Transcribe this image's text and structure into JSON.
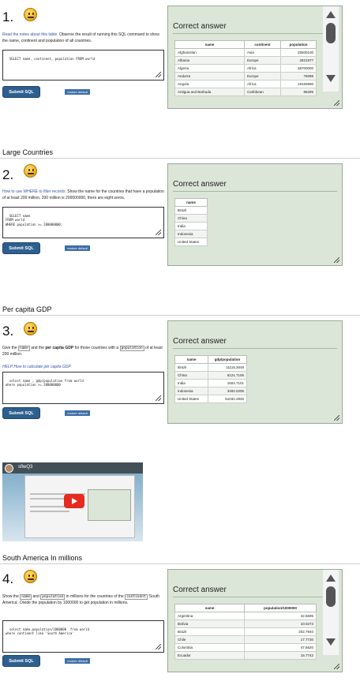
{
  "common": {
    "submit_label": "Submit SQL",
    "restore_label": "restore default",
    "answer_title": "Correct answer"
  },
  "q1": {
    "number": "1.",
    "prompt_link": "Read the notes about this table.",
    "prompt_rest": " Observe the result of running this SQL command to show the name, continent and population of all countries.",
    "sql": "SELECT name, continent, population FROM world",
    "columns": [
      "name",
      "continent",
      "population"
    ],
    "rows": [
      [
        "Afghanistan",
        "Asia",
        "25500100"
      ],
      [
        "Albania",
        "Europe",
        "2821977"
      ],
      [
        "Algeria",
        "Africa",
        "38700000"
      ],
      [
        "Andorra",
        "Europe",
        "76098"
      ],
      [
        "Angola",
        "Africa",
        "19183590"
      ],
      [
        "Antigua and Barbuda",
        "Caribbean",
        "86295"
      ]
    ]
  },
  "s2": {
    "title": "Large Countries"
  },
  "q2": {
    "number": "2.",
    "prompt_link": "How to use WHERE to filter records.",
    "prompt_rest": " Show the name for the countries that have a population of at least 200 million. 200 million is 200000000, there are eight zeros.",
    "sql": "SELECT name\nFROM world\nWHERE population >= 200000000;",
    "columns": [
      "name"
    ],
    "rows": [
      [
        "Brazil"
      ],
      [
        "China"
      ],
      [
        "India"
      ],
      [
        "Indonesia"
      ],
      [
        "United States"
      ]
    ]
  },
  "s3": {
    "title": "Per capita GDP"
  },
  "q3": {
    "number": "3.",
    "prompt_a": "Give the ",
    "code_name": "name",
    "prompt_b": " and the ",
    "bold": "per capita GDP",
    "prompt_c": " for those countries with a ",
    "code_population": "population",
    "prompt_d": " of at least 200 million.",
    "help": "HELP:How to calculate per capita GDP",
    "sql": "select name , gdp/population from world\nwhere population >= 200000000",
    "columns": [
      "name",
      "gdp/population"
    ],
    "rows": [
      [
        "Brazil",
        "11115.2648"
      ],
      [
        "China",
        "6121.7106"
      ],
      [
        "India",
        "1504.7101"
      ],
      [
        "Indonesia",
        "3482.0205"
      ],
      [
        "United States",
        "51032.2945"
      ]
    ]
  },
  "video": {
    "channel": "sflwQ3"
  },
  "s4": {
    "title": "South America In millions"
  },
  "q4": {
    "number": "4.",
    "prompt_a": "Show the ",
    "code_name": "name",
    "prompt_b": " and ",
    "code_population": "population",
    "prompt_c": " in millions for the countries of the ",
    "code_continent": "continent",
    "prompt_d": " 'South America'. Divide the population by 1000000 to get population in millions.",
    "sql": "select name,population/1000000  from world\nwhere continent like 'South America'",
    "columns": [
      "name",
      "population/1000000"
    ],
    "rows": [
      [
        "Argentina",
        "42.6695"
      ],
      [
        "Bolivia",
        "10.0273"
      ],
      [
        "Brazil",
        "202.7940"
      ],
      [
        "Chile",
        "17.7730"
      ],
      [
        "Colombia",
        "47.6620"
      ],
      [
        "Ecuador",
        "15.7742"
      ]
    ]
  }
}
